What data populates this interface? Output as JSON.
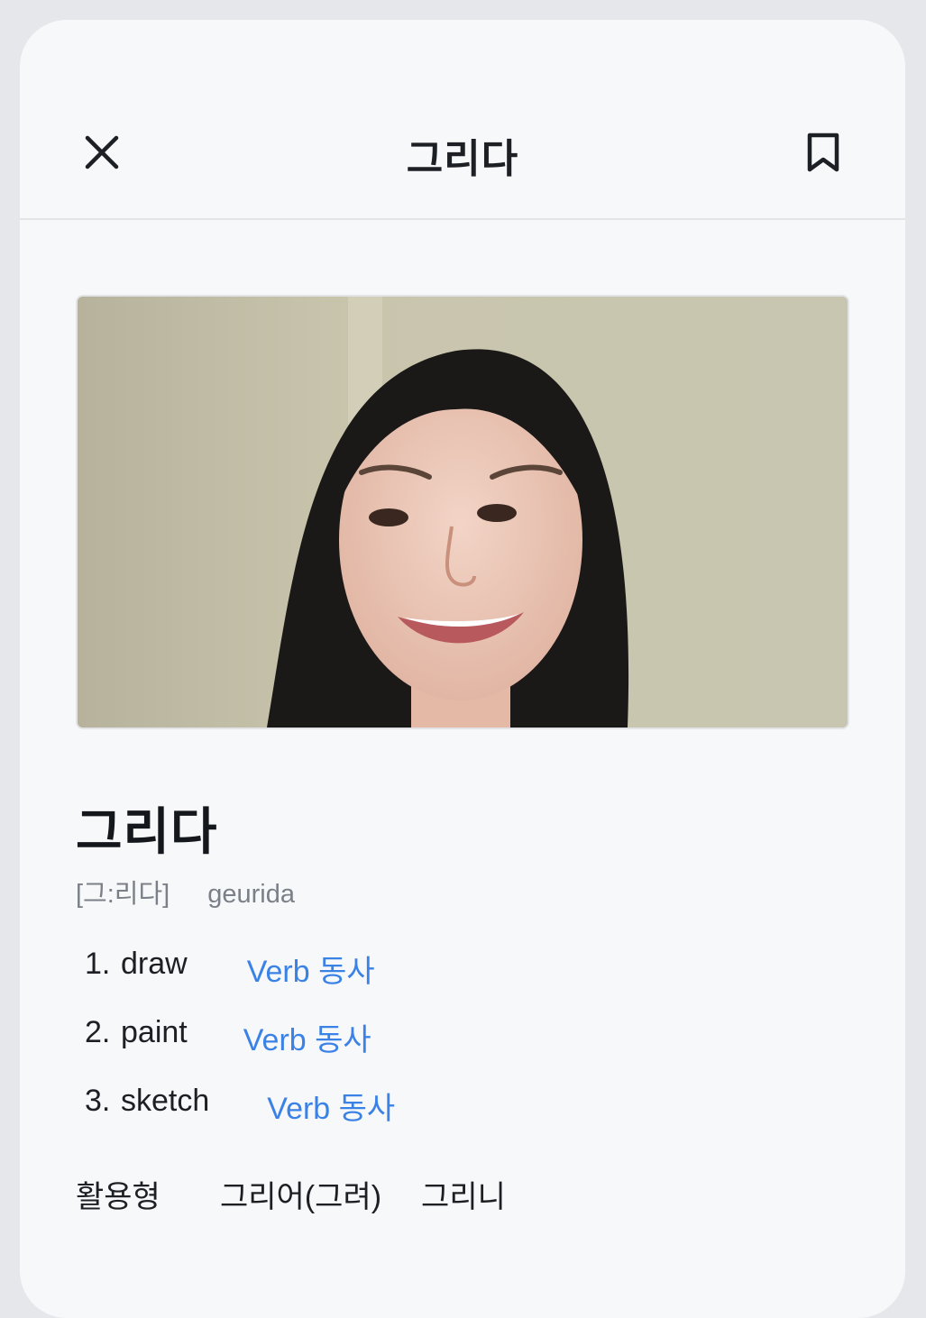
{
  "header": {
    "title": "그리다",
    "close_icon": "close-icon",
    "bookmark_icon": "bookmark-icon"
  },
  "video": {
    "content": "person-speaking-video"
  },
  "word": {
    "headword": "그리다",
    "pronunciation": "[그:리다]",
    "romanization": "geurida"
  },
  "meanings": [
    {
      "number": "1.",
      "text": "draw",
      "pos": "Verb 동사"
    },
    {
      "number": "2.",
      "text": "paint",
      "pos": "Verb 동사"
    },
    {
      "number": "3.",
      "text": "sketch",
      "pos": "Verb 동사"
    }
  ],
  "conjugation": {
    "label": "활용형",
    "forms": [
      "그리어(그려)",
      "그리니"
    ]
  },
  "colors": {
    "accent": "#3b82e6",
    "text": "#1c1f24",
    "muted": "#7b8088",
    "background": "#f7f8fa"
  }
}
